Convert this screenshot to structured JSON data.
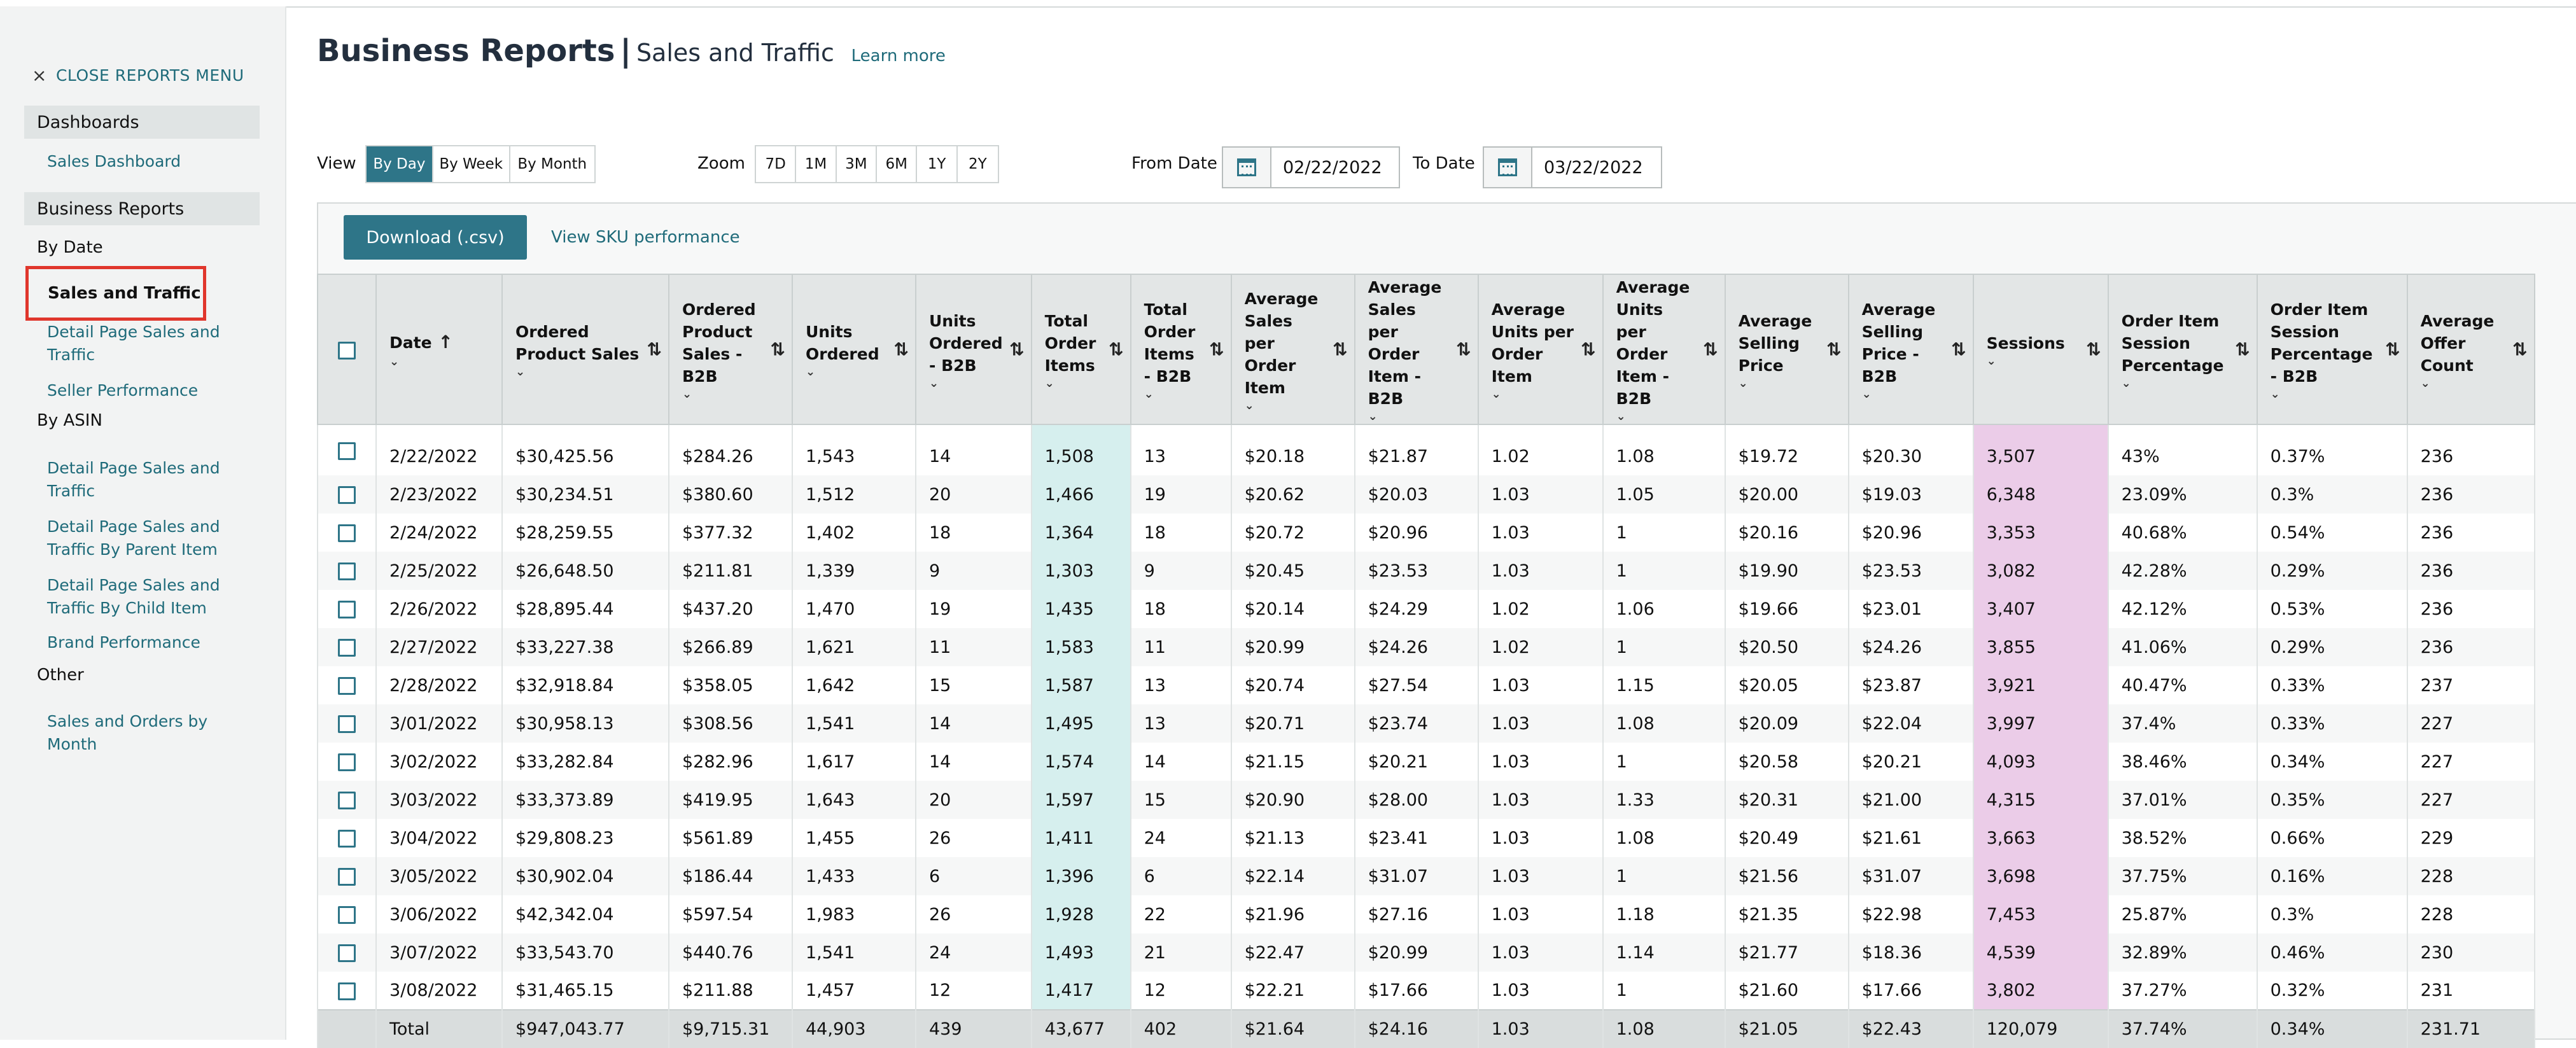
{
  "sidebar": {
    "close_label": "CLOSE REPORTS MENU",
    "dashboards_label": "Dashboards",
    "sales_dashboard": "Sales Dashboard",
    "business_reports_label": "Business Reports",
    "by_date_label": "By Date",
    "active_item": "Sales and Traffic",
    "detail_page_sales_traffic": "Detail Page Sales and Traffic",
    "seller_performance": "Seller Performance",
    "by_asin_label": "By ASIN",
    "asin_detail_page": "Detail Page Sales and Traffic",
    "asin_parent": "Detail Page Sales and Traffic By Parent Item",
    "asin_child": "Detail Page Sales and Traffic By Child Item",
    "brand_performance": "Brand Performance",
    "other_label": "Other",
    "sales_orders_month": "Sales and Orders by Month"
  },
  "header": {
    "title": "Business Reports",
    "separator": "|",
    "subtitle": "Sales and Traffic",
    "learn_more": "Learn more"
  },
  "controls": {
    "view_label": "View",
    "view_options": [
      "By Day",
      "By Week",
      "By Month"
    ],
    "zoom_label": "Zoom",
    "zoom_options": [
      "7D",
      "1M",
      "3M",
      "6M",
      "1Y",
      "2Y"
    ],
    "from_label": "From Date",
    "from_value": "02/22/2022",
    "to_label": "To Date",
    "to_value": "03/22/2022",
    "download_label": "Download (.csv)",
    "sku_link": "View SKU performance"
  },
  "table": {
    "columns": [
      "Date",
      "Ordered Product Sales",
      "Ordered Product Sales - B2B",
      "Units Ordered",
      "Units Ordered - B2B",
      "Total Order Items",
      "Total Order Items - B2B",
      "Average Sales per Order Item",
      "Average Sales per Order Item - B2B",
      "Average Units per Order Item",
      "Average Units per Order Item - B2B",
      "Average Selling Price",
      "Average Selling Price - B2B",
      "Sessions",
      "Order Item Session Percentage",
      "Order Item Session Percentage - B2B",
      "Average Offer Count"
    ],
    "rows": [
      [
        "2/22/2022",
        "$30,425.56",
        "$284.26",
        "1,543",
        "14",
        "1,508",
        "13",
        "$20.18",
        "$21.87",
        "1.02",
        "1.08",
        "$19.72",
        "$20.30",
        "3,507",
        "43%",
        "0.37%",
        "236"
      ],
      [
        "2/23/2022",
        "$30,234.51",
        "$380.60",
        "1,512",
        "20",
        "1,466",
        "19",
        "$20.62",
        "$20.03",
        "1.03",
        "1.05",
        "$20.00",
        "$19.03",
        "6,348",
        "23.09%",
        "0.3%",
        "236"
      ],
      [
        "2/24/2022",
        "$28,259.55",
        "$377.32",
        "1,402",
        "18",
        "1,364",
        "18",
        "$20.72",
        "$20.96",
        "1.03",
        "1",
        "$20.16",
        "$20.96",
        "3,353",
        "40.68%",
        "0.54%",
        "236"
      ],
      [
        "2/25/2022",
        "$26,648.50",
        "$211.81",
        "1,339",
        "9",
        "1,303",
        "9",
        "$20.45",
        "$23.53",
        "1.03",
        "1",
        "$19.90",
        "$23.53",
        "3,082",
        "42.28%",
        "0.29%",
        "236"
      ],
      [
        "2/26/2022",
        "$28,895.44",
        "$437.20",
        "1,470",
        "19",
        "1,435",
        "18",
        "$20.14",
        "$24.29",
        "1.02",
        "1.06",
        "$19.66",
        "$23.01",
        "3,407",
        "42.12%",
        "0.53%",
        "236"
      ],
      [
        "2/27/2022",
        "$33,227.38",
        "$266.89",
        "1,621",
        "11",
        "1,583",
        "11",
        "$20.99",
        "$24.26",
        "1.02",
        "1",
        "$20.50",
        "$24.26",
        "3,855",
        "41.06%",
        "0.29%",
        "236"
      ],
      [
        "2/28/2022",
        "$32,918.84",
        "$358.05",
        "1,642",
        "15",
        "1,587",
        "13",
        "$20.74",
        "$27.54",
        "1.03",
        "1.15",
        "$20.05",
        "$23.87",
        "3,921",
        "40.47%",
        "0.33%",
        "237"
      ],
      [
        "3/01/2022",
        "$30,958.13",
        "$308.56",
        "1,541",
        "14",
        "1,495",
        "13",
        "$20.71",
        "$23.74",
        "1.03",
        "1.08",
        "$20.09",
        "$22.04",
        "3,997",
        "37.4%",
        "0.33%",
        "227"
      ],
      [
        "3/02/2022",
        "$33,282.84",
        "$282.96",
        "1,617",
        "14",
        "1,574",
        "14",
        "$21.15",
        "$20.21",
        "1.03",
        "1",
        "$20.58",
        "$20.21",
        "4,093",
        "38.46%",
        "0.34%",
        "227"
      ],
      [
        "3/03/2022",
        "$33,373.89",
        "$419.95",
        "1,643",
        "20",
        "1,597",
        "15",
        "$20.90",
        "$28.00",
        "1.03",
        "1.33",
        "$20.31",
        "$21.00",
        "4,315",
        "37.01%",
        "0.35%",
        "227"
      ],
      [
        "3/04/2022",
        "$29,808.23",
        "$561.89",
        "1,455",
        "26",
        "1,411",
        "24",
        "$21.13",
        "$23.41",
        "1.03",
        "1.08",
        "$20.49",
        "$21.61",
        "3,663",
        "38.52%",
        "0.66%",
        "229"
      ],
      [
        "3/05/2022",
        "$30,902.04",
        "$186.44",
        "1,433",
        "6",
        "1,396",
        "6",
        "$22.14",
        "$31.07",
        "1.03",
        "1",
        "$21.56",
        "$31.07",
        "3,698",
        "37.75%",
        "0.16%",
        "228"
      ],
      [
        "3/06/2022",
        "$42,342.04",
        "$597.54",
        "1,983",
        "26",
        "1,928",
        "22",
        "$21.96",
        "$27.16",
        "1.03",
        "1.18",
        "$21.35",
        "$22.98",
        "7,453",
        "25.87%",
        "0.3%",
        "228"
      ],
      [
        "3/07/2022",
        "$33,543.70",
        "$440.76",
        "1,541",
        "24",
        "1,493",
        "21",
        "$22.47",
        "$20.99",
        "1.03",
        "1.14",
        "$21.77",
        "$18.36",
        "4,539",
        "32.89%",
        "0.46%",
        "230"
      ],
      [
        "3/08/2022",
        "$31,465.15",
        "$211.88",
        "1,457",
        "12",
        "1,417",
        "12",
        "$22.21",
        "$17.66",
        "1.03",
        "1",
        "$21.60",
        "$17.66",
        "3,802",
        "37.27%",
        "0.32%",
        "231"
      ]
    ],
    "total": [
      "Total",
      "$947,043.77",
      "$9,715.31",
      "44,903",
      "439",
      "43,677",
      "402",
      "$21.64",
      "$24.16",
      "1.03",
      "1.08",
      "$21.05",
      "$22.43",
      "120,079",
      "37.74%",
      "0.34%",
      "231.71"
    ]
  }
}
